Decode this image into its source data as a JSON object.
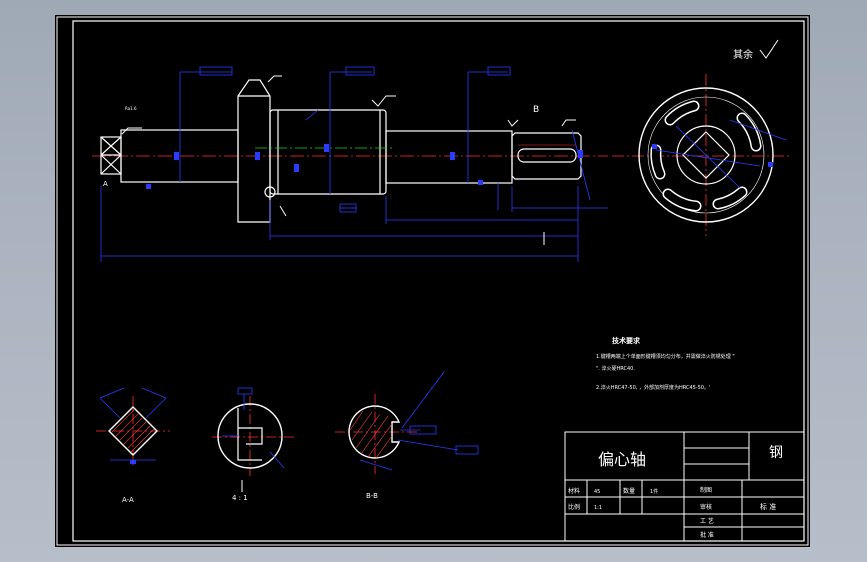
{
  "drawing": {
    "part_name": "偏心轴",
    "material": "钢",
    "roughness_note": "其余",
    "view_labels": {
      "section_a": "A-A",
      "section_c": "4 : 1",
      "section_b": "B-B",
      "view_b_marker": "B",
      "view_a_marker": "A",
      "main_view_a": "A"
    },
    "tech_req": {
      "title": "技术要求",
      "line1": "1.键槽两端上个单面形键槽须均匀分布，并需做淬火防锈处理 \"",
      "line2": "\". 淬火硬HRC40.",
      "line3": "2.淬火HRC47-50, ，外部加剂厚度为HRC45-50。'"
    },
    "title_block": {
      "label_material": "材料",
      "value_material": "45",
      "label_qty": "数量",
      "value_qty": "1件",
      "label_scale": "比例",
      "value_scale": "1:1",
      "label_drawn": "制图",
      "label_check": "审核",
      "label_process": "工 艺",
      "label_approve": "批 准",
      "label_standard": "标 准"
    }
  }
}
